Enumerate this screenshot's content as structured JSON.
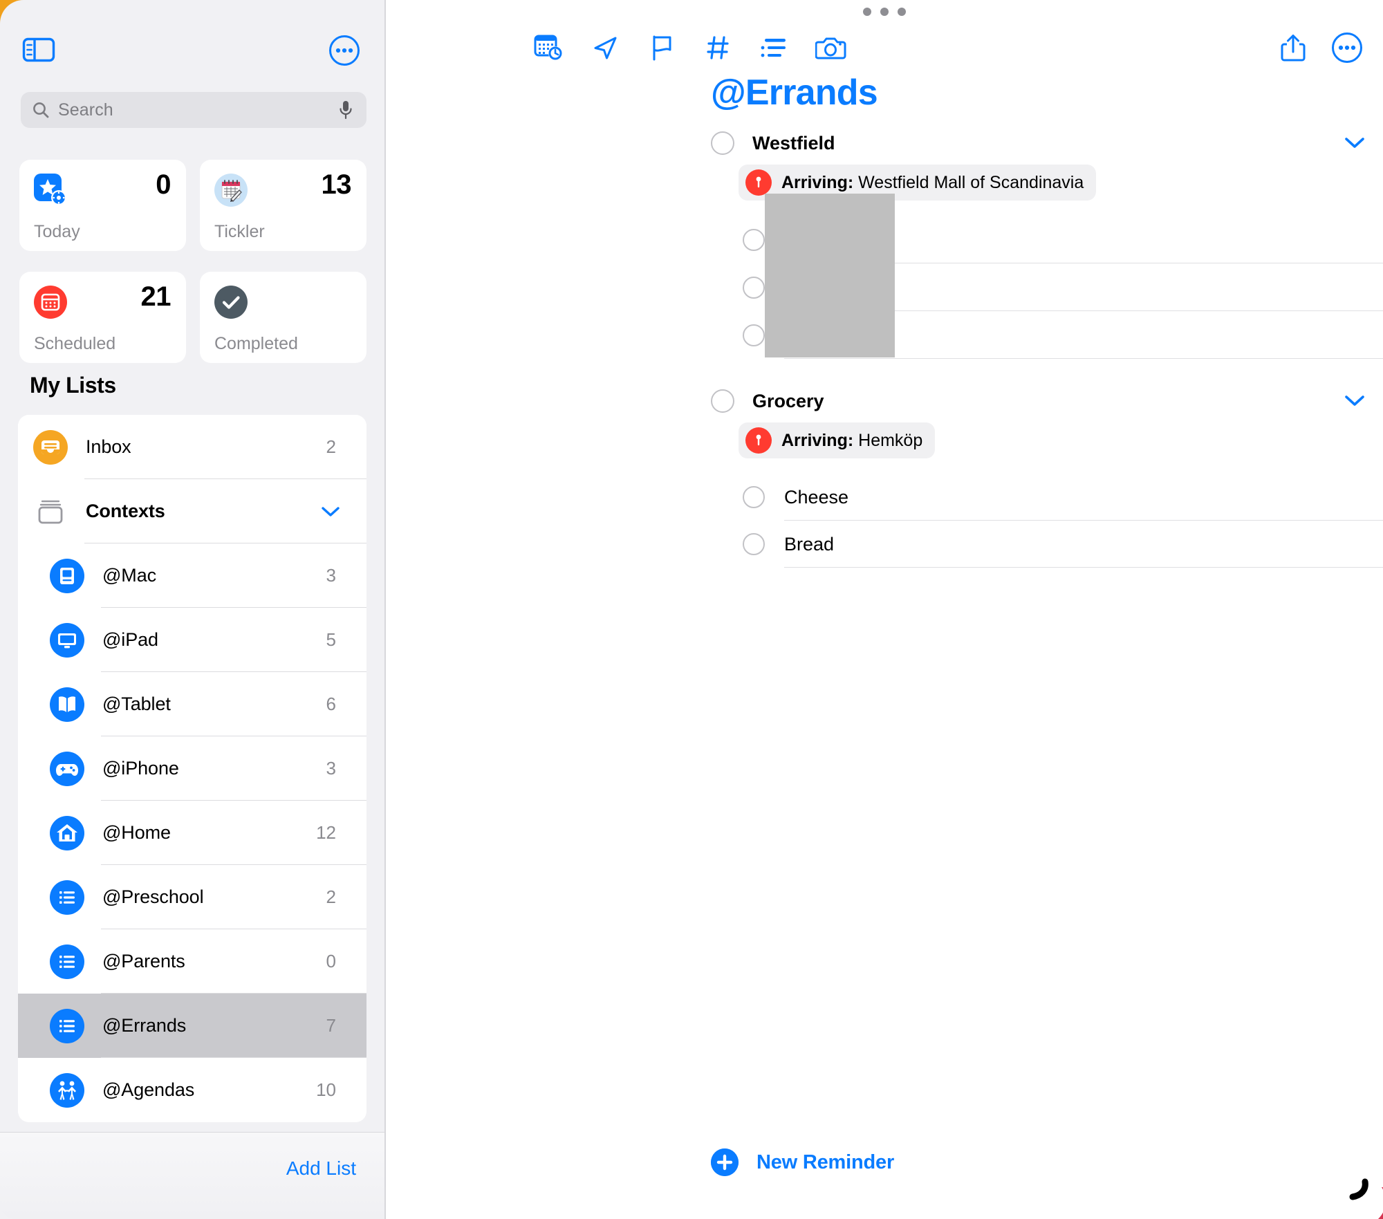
{
  "app": {
    "accent_blue": "#0a7cff",
    "sidebar_bg": "#f1f1f4",
    "selected_row_bg": "#c9c9cd"
  },
  "sidebar": {
    "toggle_icon": "sidebar-toggle-icon",
    "more_icon": "more-circle-icon",
    "search": {
      "placeholder": "Search",
      "search_icon": "search-icon",
      "mic_icon": "microphone-icon"
    },
    "smart_lists": [
      {
        "label": "Today",
        "count": "0",
        "icon": "star-gear-icon",
        "icon_color": "#0a7cff"
      },
      {
        "label": "Tickler",
        "count": "13",
        "icon": "calendar-note-icon",
        "icon_color": "#bcdcf5"
      },
      {
        "label": "Scheduled",
        "count": "21",
        "icon": "calendar-icon",
        "icon_color": "#ff3b30"
      },
      {
        "label": "Completed",
        "count": "",
        "icon": "checkmark-icon",
        "icon_color": "#4d5a63"
      }
    ],
    "my_lists_heading": "My Lists",
    "lists": [
      {
        "label": "Inbox",
        "count": "2",
        "icon": "inbox-tray-icon",
        "icon_color": "#f5a623",
        "indent": false,
        "bold": false,
        "chevron": false,
        "selected": false
      },
      {
        "label": "Contexts",
        "count": "",
        "icon": "group-folder-icon",
        "icon_color": "#8a8a8f",
        "indent": false,
        "bold": true,
        "chevron": true,
        "selected": false
      },
      {
        "label": "@Mac",
        "count": "3",
        "icon": "desktop-computer-icon",
        "icon_color": "#0a7cff",
        "indent": true,
        "bold": false,
        "chevron": false,
        "selected": false
      },
      {
        "label": "@iPad",
        "count": "5",
        "icon": "monitor-icon",
        "icon_color": "#0a7cff",
        "indent": true,
        "bold": false,
        "chevron": false,
        "selected": false
      },
      {
        "label": "@Tablet",
        "count": "6",
        "icon": "book-icon",
        "icon_color": "#0a7cff",
        "indent": true,
        "bold": false,
        "chevron": false,
        "selected": false
      },
      {
        "label": "@iPhone",
        "count": "3",
        "icon": "gamecontroller-icon",
        "icon_color": "#0a7cff",
        "indent": true,
        "bold": false,
        "chevron": false,
        "selected": false
      },
      {
        "label": "@Home",
        "count": "12",
        "icon": "house-icon",
        "icon_color": "#0a7cff",
        "indent": true,
        "bold": false,
        "chevron": false,
        "selected": false
      },
      {
        "label": "@Preschool",
        "count": "2",
        "icon": "list-bullet-icon",
        "icon_color": "#0a7cff",
        "indent": true,
        "bold": false,
        "chevron": false,
        "selected": false
      },
      {
        "label": "@Parents",
        "count": "0",
        "icon": "list-bullet-icon",
        "icon_color": "#0a7cff",
        "indent": true,
        "bold": false,
        "chevron": false,
        "selected": false
      },
      {
        "label": "@Errands",
        "count": "7",
        "icon": "list-bullet-icon",
        "icon_color": "#0a7cff",
        "indent": true,
        "bold": false,
        "chevron": false,
        "selected": true
      },
      {
        "label": "@Agendas",
        "count": "10",
        "icon": "two-people-icon",
        "icon_color": "#0a7cff",
        "indent": true,
        "bold": false,
        "chevron": false,
        "selected": false
      }
    ],
    "add_list_label": "Add List"
  },
  "main": {
    "drag_handle": "drag-handle-dots",
    "toolbar_left": [
      {
        "name": "calendar-clock-icon"
      },
      {
        "name": "location-arrow-icon"
      },
      {
        "name": "flag-icon"
      },
      {
        "name": "hashtag-icon"
      },
      {
        "name": "indent-list-icon"
      },
      {
        "name": "camera-icon"
      }
    ],
    "toolbar_right": [
      {
        "name": "share-icon"
      },
      {
        "name": "more-circle-icon"
      }
    ],
    "list_title": "@Errands",
    "groups": [
      {
        "title": "Westfield",
        "location_prefix": "Arriving:",
        "location_value": "Westfield Mall of Scandinavia",
        "chevron": "chevron-down-icon",
        "items": [
          {
            "label": ""
          },
          {
            "label": ""
          },
          {
            "label": ""
          }
        ],
        "redacted": true
      },
      {
        "title": "Grocery",
        "location_prefix": "Arriving:",
        "location_value": "Hemköp",
        "chevron": "chevron-down-icon",
        "items": [
          {
            "label": "Cheese"
          },
          {
            "label": "Bread"
          }
        ],
        "redacted": false
      }
    ],
    "new_reminder_label": "New Reminder",
    "new_reminder_icon": "plus-circle-icon"
  }
}
